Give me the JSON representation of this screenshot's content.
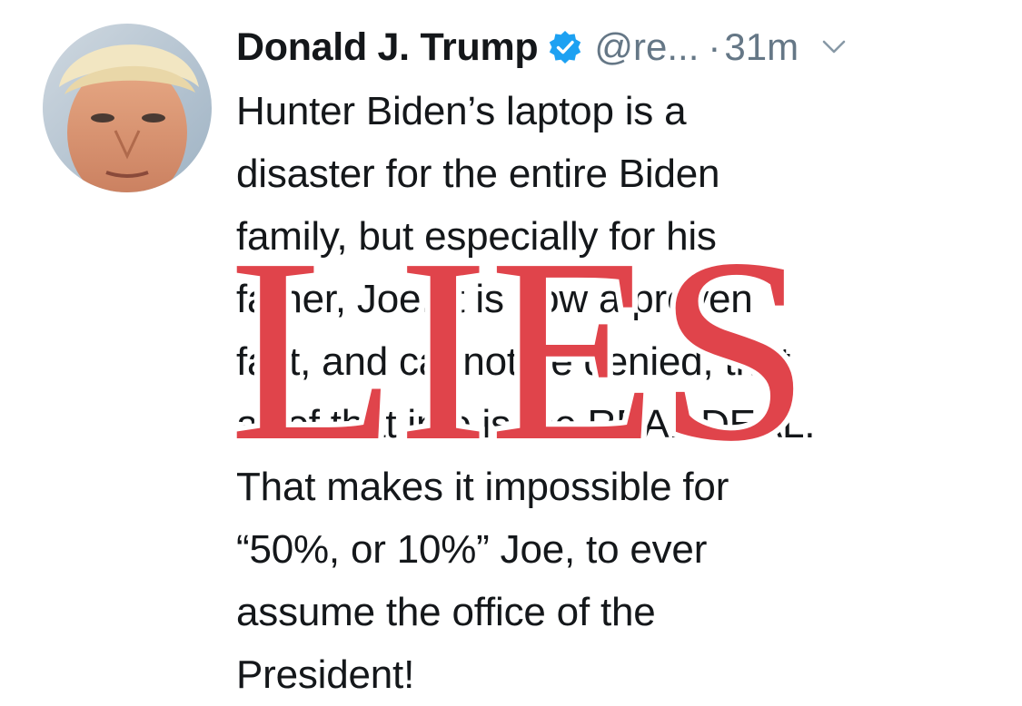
{
  "tweet": {
    "display_name": "Donald J. Trump",
    "handle": "@re...",
    "separator": "·",
    "time": "31m",
    "lines": [
      "Hunter Biden’s laptop is a",
      "disaster for the entire Biden",
      "family, but especially for his",
      "father, Joe. It is now a proven",
      "fact, and cannot be denied, that",
      "all of that info is the REAL DEAL.",
      "That makes it impossible for",
      "“50%, or 10%” Joe, to ever",
      "assume the office of the",
      "President!"
    ]
  },
  "stamp": {
    "text": "LIES",
    "color": "#e0444b"
  },
  "colors": {
    "text": "#14171a",
    "muted": "#657786",
    "verified": "#1da1f2"
  },
  "icons": {
    "verified": "verified-badge-icon",
    "menu": "chevron-down-icon"
  }
}
